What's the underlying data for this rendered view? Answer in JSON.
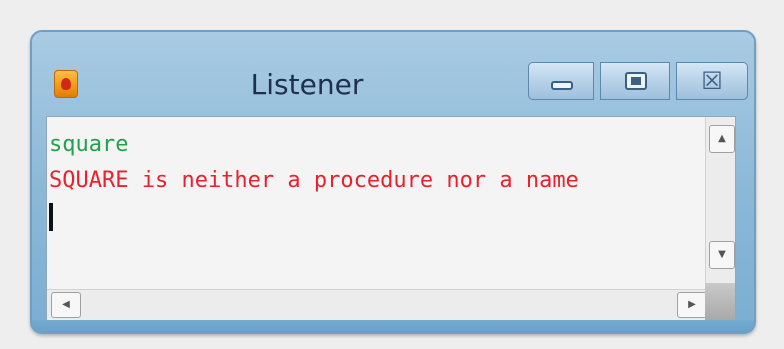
{
  "window": {
    "title": "Listener",
    "app_icon": "logo-app-icon",
    "controls": {
      "minimize_icon": "minimize-icon",
      "maximize_icon": "maximize-icon",
      "close_icon": "close-icon",
      "close_glyph": "☒"
    }
  },
  "console": {
    "lines": [
      {
        "text": "square",
        "type": "command"
      },
      {
        "text": "SQUARE is neither a procedure nor a name",
        "type": "error"
      }
    ]
  },
  "scrollbar": {
    "up_glyph": "▲",
    "down_glyph": "▼",
    "left_glyph": "◀",
    "right_glyph": "▶"
  },
  "colors": {
    "command_text": "#23a04a",
    "error_text": "#e8222c",
    "title_bar": "#8db9d8",
    "content_bg": "#f4f4f4"
  }
}
